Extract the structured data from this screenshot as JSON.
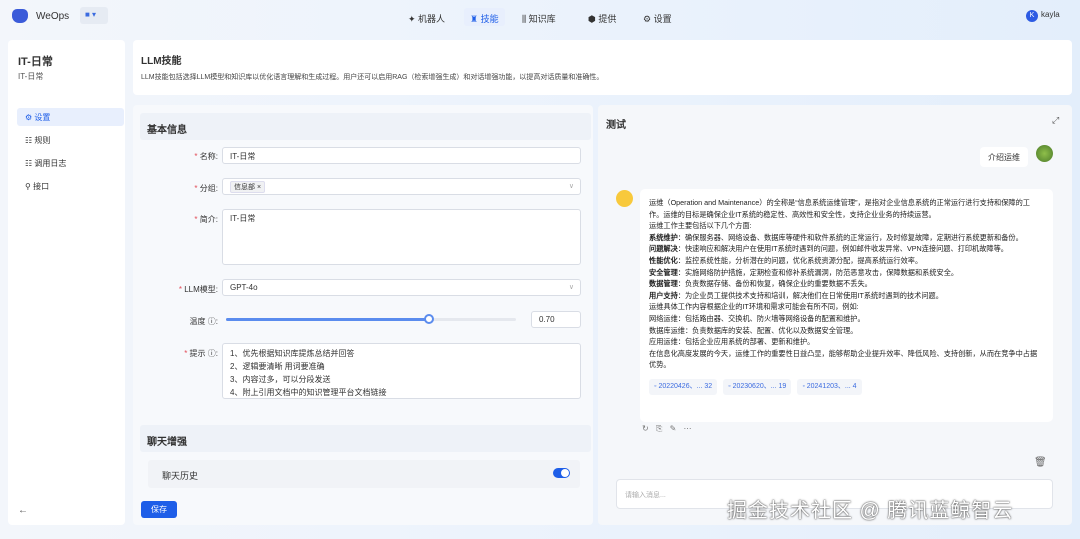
{
  "app": {
    "brand": "WeOps",
    "user": "kayla",
    "user_initial": "K"
  },
  "nav": [
    {
      "label": "机器人",
      "icon": "robot-icon"
    },
    {
      "label": "技能",
      "icon": "skill-icon",
      "active": true
    },
    {
      "label": "知识库",
      "icon": "library-icon"
    },
    {
      "label": "提供",
      "icon": "provider-icon"
    },
    {
      "label": "设置",
      "icon": "gear-icon"
    }
  ],
  "sidebar": {
    "title": "IT-日常",
    "subtitle": "IT-日常",
    "items": [
      {
        "label": "设置",
        "icon": "⚙",
        "active": true
      },
      {
        "label": "规则",
        "icon": "☷"
      },
      {
        "label": "调用日志",
        "icon": "☷"
      },
      {
        "label": "接口",
        "icon": "⚲"
      }
    ]
  },
  "header": {
    "title": "LLM技能",
    "description": "LLM技能包括选择LLM模型和知识库以优化语言理解和生成过程。用户还可以启用RAG（检索增强生成）和对话增强功能，以提高对话质量和准确性。"
  },
  "form": {
    "section_basic": "基本信息",
    "name_label": "名称:",
    "name_value": "IT-日常",
    "group_label": "分组:",
    "group_tag": "信息部",
    "intro_label": "简介:",
    "intro_value": "IT-日常",
    "model_label": "LLM模型:",
    "model_value": "GPT-4o",
    "temp_label": "温度",
    "temp_value": "0.70",
    "temp_fraction": 0.7,
    "prompt_label": "提示",
    "prompt_lines": [
      "1、优先根据知识库提炼总结并回答",
      "2、逻辑要清晰 用词要准确",
      "3、内容过多，可以分段发送",
      "4、附上引用文档中的知识管理平台文档链接"
    ],
    "section_chat": "聊天增强",
    "history_label": "聊天历史",
    "history_enabled": true,
    "save_label": "保存"
  },
  "test": {
    "title": "测试",
    "user_message": "介绍运维",
    "reply": [
      {
        "t": "运维（Operation and Maintenance）的全称是“信息系统运维管理”，是指对企业信息系统的正常运行进行支持和保障的工作。运维的目标是确保企业IT系统的稳定性、高效性和安全性，支持企业业务的持续运营。"
      },
      {
        "t": "运维工作主要包括以下几个方面:"
      },
      {
        "b": "系统维护",
        "t": "：确保服务器、网络设备、数据库等硬件和软件系统的正常运行，及时修复故障，定期进行系统更新和备份。"
      },
      {
        "b": "问题解决",
        "t": "：快速响应和解决用户在使用IT系统时遇到的问题，例如邮件收发异常、VPN连接问题、打印机故障等。"
      },
      {
        "b": "性能优化",
        "t": "：监控系统性能，分析潜在的问题，优化系统资源分配，提高系统运行效率。"
      },
      {
        "b": "安全管理",
        "t": "：实施网络防护措施，定期检查和修补系统漏洞，防范恶意攻击，保障数据和系统安全。"
      },
      {
        "b": "数据管理",
        "t": "：负责数据存储、备份和恢复，确保企业的重要数据不丢失。"
      },
      {
        "b": "用户支持",
        "t": "：为企业员工提供技术支持和培训，解决他们在日常使用IT系统时遇到的技术问题。"
      },
      {
        "t": "运维具体工作内容根据企业的IT环境和需求可能会有所不同，例如:"
      },
      {
        "t": "网络运维：包括路由器、交换机、防火墙等网络设备的配置和维护。"
      },
      {
        "t": "数据库运维：负责数据库的安装、配置、优化以及数据安全管理。"
      },
      {
        "t": "应用运维：包括企业应用系统的部署、更新和维护。"
      },
      {
        "t": "在信息化高度发展的今天，运维工作的重要性日益凸显，能够帮助企业提升效率、降低风险、支持创新，从而在竞争中占据优势。"
      }
    ],
    "refs": [
      "20220426、... 32",
      "20230620、... 19",
      "20241203、... 4"
    ],
    "input_placeholder": "请输入消息..."
  },
  "watermark": "掘金技术社区 @ 腾讯蓝鲸智云"
}
